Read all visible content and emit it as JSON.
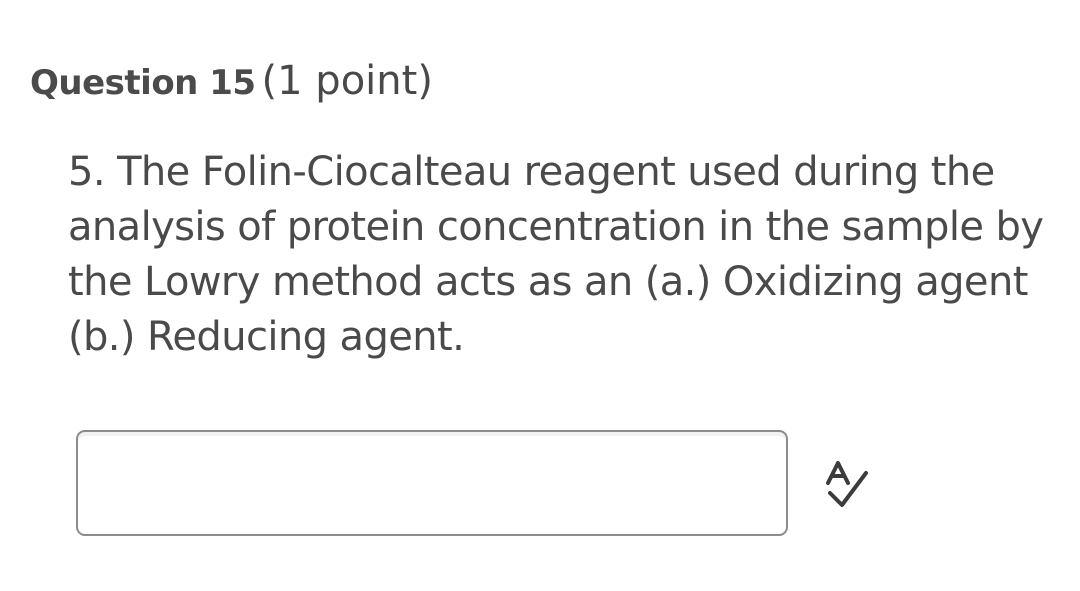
{
  "question": {
    "title": "Question 15",
    "points": "(1 point)",
    "text": "5. The Folin-Ciocalteau reagent used during the analysis of protein concentration in the sample by the Lowry method acts as an (a.) Oxidizing agent (b.) Reducing agent."
  },
  "answer": {
    "value": "",
    "placeholder": ""
  },
  "spellcheck": {
    "icon": "spellcheck-icon",
    "color": "#3c3c3c"
  }
}
